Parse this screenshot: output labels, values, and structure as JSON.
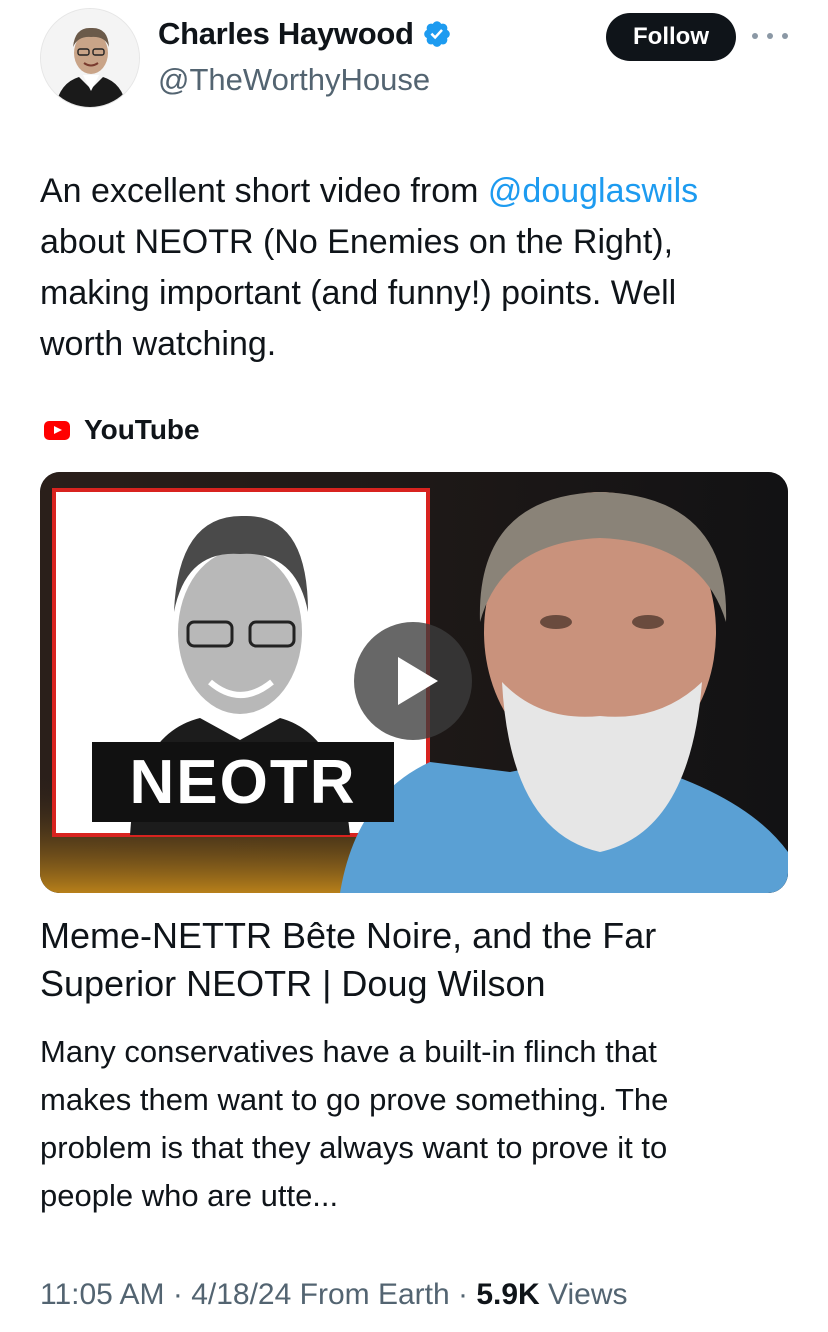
{
  "author": {
    "display_name": "Charles Haywood",
    "handle": "@TheWorthyHouse",
    "verified_icon": "verified-badge-icon",
    "avatar_icon": "avatar"
  },
  "actions": {
    "follow_label": "Follow",
    "more_icon": "more-options-icon"
  },
  "tweet": {
    "lines": [
      {
        "text": "An excellent short video from ",
        "mention": "@douglaswils"
      },
      {
        "text": "about NEOTR (No Enemies on the Right),"
      },
      {
        "text": "making important (and funny!) points.  Well"
      },
      {
        "text": "worth watching."
      }
    ]
  },
  "card": {
    "source_label": "YouTube",
    "source_icon": "youtube-icon",
    "thumbnail_caption": "NEOTR",
    "title_lines": [
      "Meme-NETTR Bête Noire, and the Far",
      "Superior NEOTR | Doug Wilson"
    ],
    "description_lines": [
      "Many conservatives have a built-in flinch that",
      "makes them want to go prove something. The",
      "problem is that they always want to prove it to",
      "people who are utte..."
    ]
  },
  "meta": {
    "time": "11:05 AM",
    "sep1": " · ",
    "date": "4/18/24",
    "from": " From Earth",
    "sep2": " · ",
    "views_count": "5.9K",
    "views_label": " Views"
  },
  "colors": {
    "accent": "#1d9bf0",
    "text": "#0f1419",
    "muted": "#536471",
    "youtube_red": "#ff0000"
  }
}
